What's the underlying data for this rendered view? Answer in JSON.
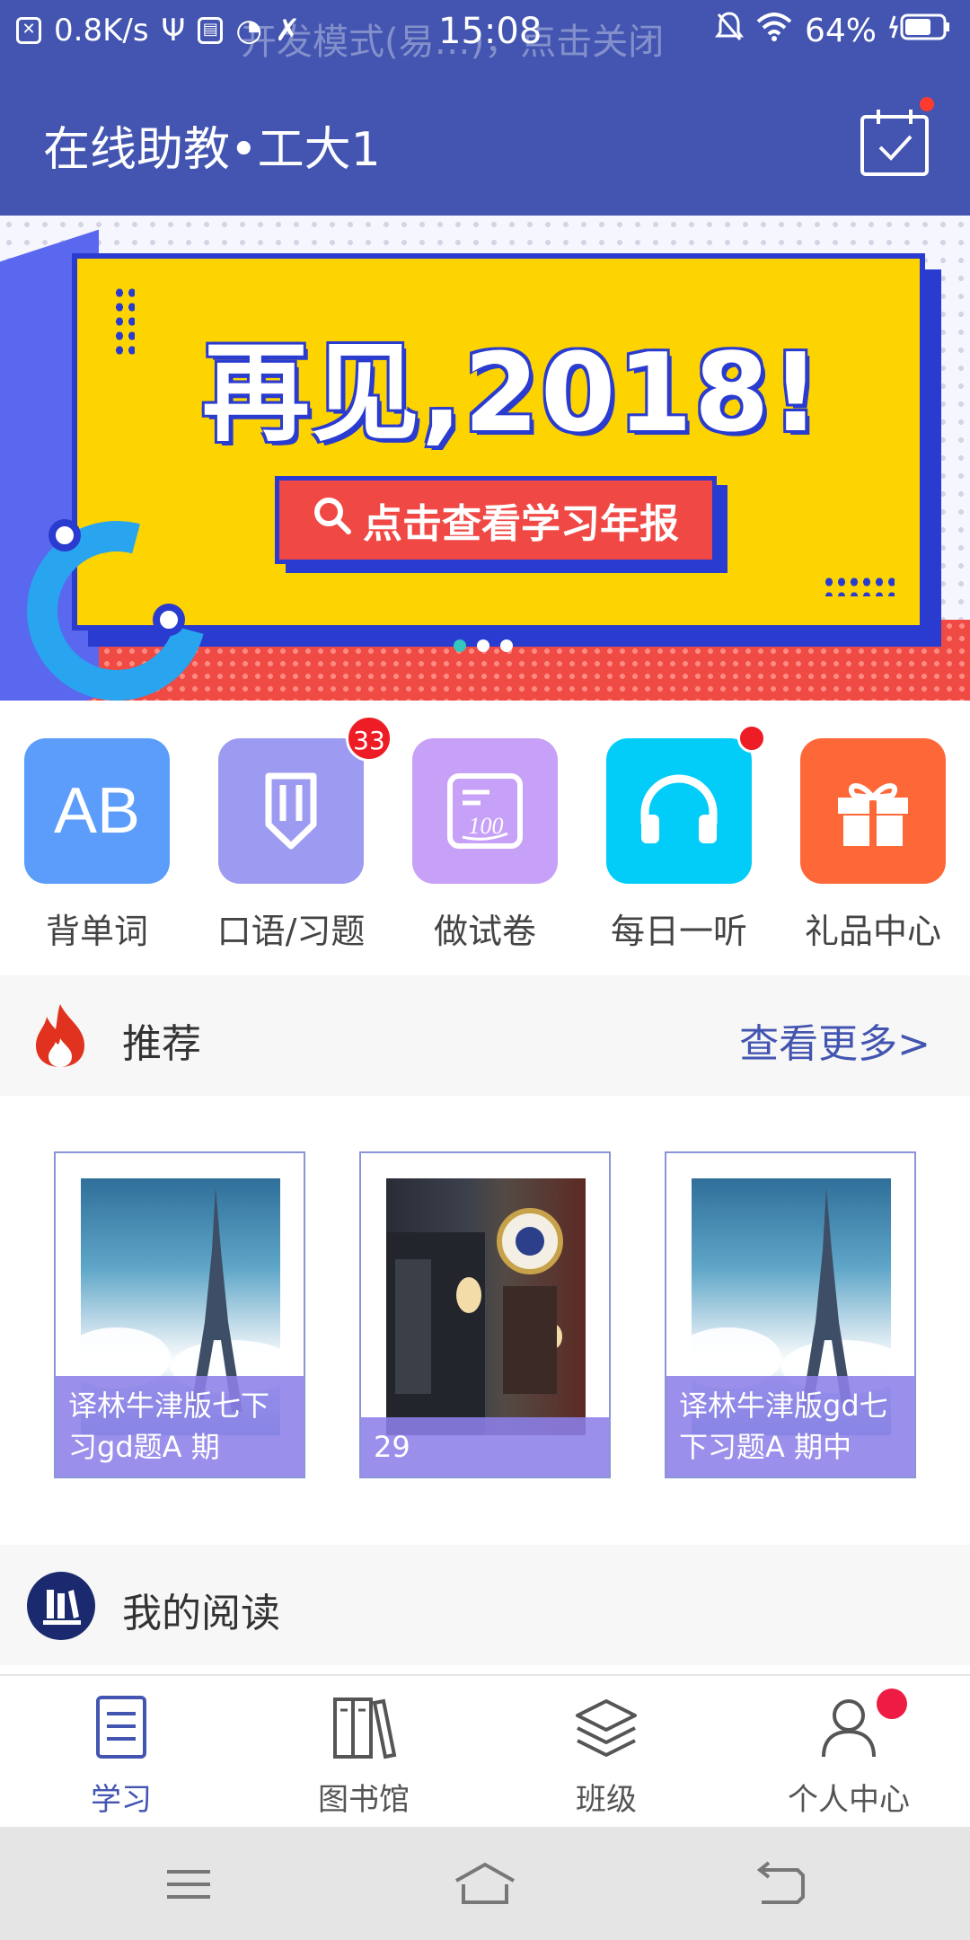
{
  "status_bar": {
    "net_speed": "0.8K/s",
    "ghost_text": "开发模式(易…)，点击关闭",
    "time": "15:08",
    "battery": "64%"
  },
  "header": {
    "title": "在线助教•工大1",
    "calendar_icon": "calendar-check-icon",
    "accent": "#4355b0"
  },
  "banner": {
    "headline": "再见,2018!",
    "button_label": "点击查看学习年报",
    "pager_count": 3,
    "active_index": 0
  },
  "tiles": [
    {
      "label": "背单词",
      "icon": "ab-letters-icon",
      "color": "#5c9dfb",
      "badge": null
    },
    {
      "label": "口语/习题",
      "icon": "pencil-icon",
      "color": "#9c9bf1",
      "badge": "33"
    },
    {
      "label": "做试卷",
      "icon": "test-paper-icon",
      "color": "#c7a0f7",
      "badge": null
    },
    {
      "label": "每日一听",
      "icon": "headphones-icon",
      "color": "#02cdf8",
      "badge": "dot"
    },
    {
      "label": "礼品中心",
      "icon": "gift-icon",
      "color": "#fe6838",
      "badge": null
    }
  ],
  "recommend": {
    "title": "推荐",
    "more": "查看更多>",
    "cards": [
      {
        "caption": "译林牛津版七下习gd题A 期",
        "image": "eiffel-tower"
      },
      {
        "caption": "29",
        "image": "cafe-sign"
      },
      {
        "caption": "译林牛津版gd七下习题A 期中",
        "image": "eiffel-tower"
      }
    ]
  },
  "reading": {
    "title": "我的阅读"
  },
  "bottom_nav": [
    {
      "label": "学习",
      "icon": "document-icon",
      "active": true
    },
    {
      "label": "图书馆",
      "icon": "books-icon",
      "active": false
    },
    {
      "label": "班级",
      "icon": "layers-icon",
      "active": false
    },
    {
      "label": "个人中心",
      "icon": "user-icon",
      "active": false,
      "dot": true
    }
  ]
}
